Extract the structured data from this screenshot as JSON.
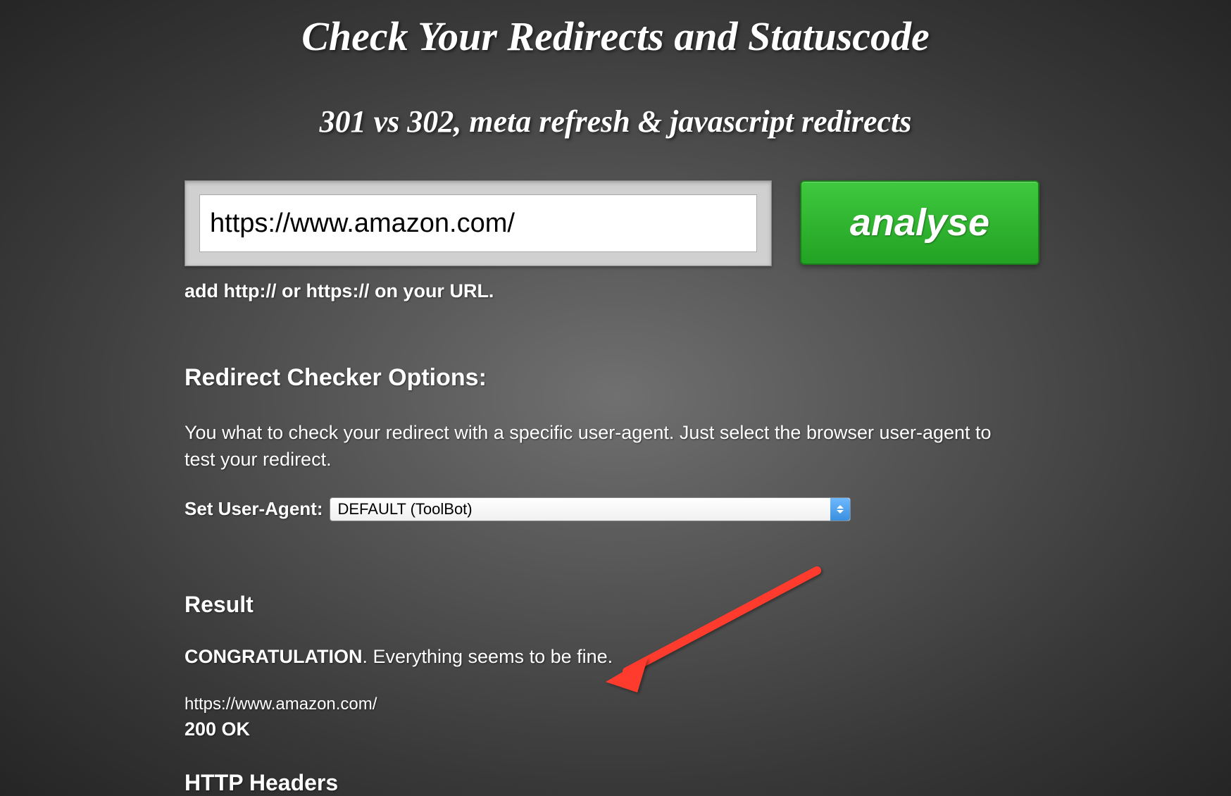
{
  "title": "Check Your Redirects and Statuscode",
  "subtitle": "301 vs 302, meta refresh & javascript redirects",
  "form": {
    "url_value": "https://www.amazon.com/",
    "analyse_label": "analyse",
    "hint": "add http:// or https:// on your URL."
  },
  "options": {
    "heading": "Redirect Checker Options:",
    "description": "You what to check your redirect with a specific user-agent. Just select the browser user-agent to test your redirect.",
    "ua_label": "Set User-Agent:",
    "ua_selected": "DEFAULT (ToolBot)"
  },
  "result": {
    "heading": "Result",
    "congrats_strong": "CONGRATULATION",
    "congrats_rest": ". Everything seems to be fine.",
    "url": "https://www.amazon.com/",
    "status": "200 OK"
  },
  "headers": {
    "heading": "HTTP Headers"
  },
  "colors": {
    "analyse_bg": "#2eb82e"
  }
}
